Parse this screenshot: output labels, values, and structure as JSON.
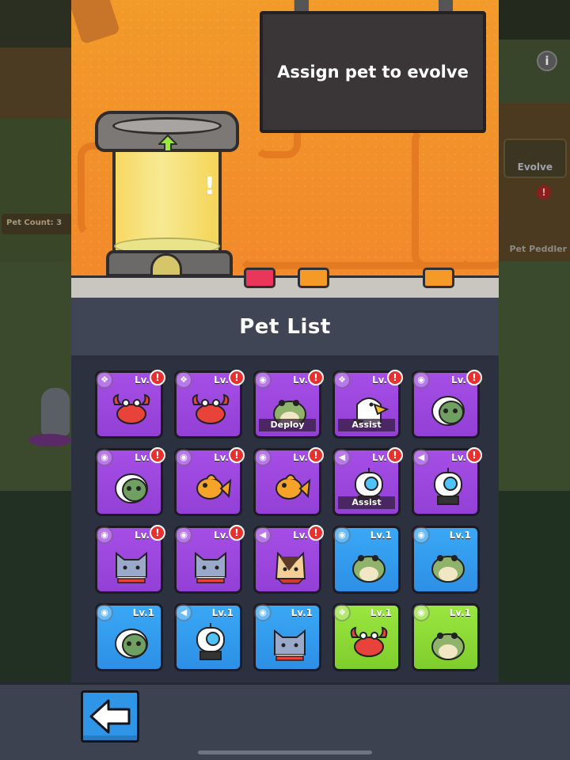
{
  "background": {
    "pet_count_label": "Pet Count: 3",
    "evolve_label": "Evolve",
    "peddler_label": "Pet Peddler",
    "info_icon": "i"
  },
  "sign": {
    "text": "Assign pet to evolve"
  },
  "pet_list": {
    "title": "Pet List",
    "pets": [
      {
        "name": "crab",
        "rarity": "purple",
        "level": "Lv.",
        "alert": "!",
        "type_icon": "❖",
        "tag": ""
      },
      {
        "name": "crab",
        "rarity": "purple",
        "level": "Lv.",
        "alert": "!",
        "type_icon": "❖",
        "tag": ""
      },
      {
        "name": "frog",
        "rarity": "purple",
        "level": "Lv.",
        "alert": "!",
        "type_icon": "◉",
        "tag": "Deploy"
      },
      {
        "name": "eagle",
        "rarity": "purple",
        "level": "Lv.",
        "alert": "!",
        "type_icon": "❖",
        "tag": "Assist"
      },
      {
        "name": "turtle",
        "rarity": "purple",
        "level": "Lv.",
        "alert": "!",
        "type_icon": "◉",
        "tag": ""
      },
      {
        "name": "turtle",
        "rarity": "purple",
        "level": "Lv.",
        "alert": "!",
        "type_icon": "◉",
        "tag": ""
      },
      {
        "name": "goldfish",
        "rarity": "purple",
        "level": "Lv.",
        "alert": "!",
        "type_icon": "◉",
        "tag": ""
      },
      {
        "name": "goldfish",
        "rarity": "purple",
        "level": "Lv.",
        "alert": "!",
        "type_icon": "◉",
        "tag": ""
      },
      {
        "name": "robot",
        "rarity": "purple",
        "level": "Lv.",
        "alert": "!",
        "type_icon": "◀",
        "tag": "Assist"
      },
      {
        "name": "robot",
        "rarity": "purple",
        "level": "Lv.",
        "alert": "!",
        "type_icon": "◀",
        "tag": ""
      },
      {
        "name": "cat",
        "rarity": "purple",
        "level": "Lv.",
        "alert": "!",
        "type_icon": "◉",
        "tag": ""
      },
      {
        "name": "cat",
        "rarity": "purple",
        "level": "Lv.",
        "alert": "!",
        "type_icon": "◉",
        "tag": ""
      },
      {
        "name": "dog",
        "rarity": "purple",
        "level": "Lv.",
        "alert": "!",
        "type_icon": "◀",
        "tag": ""
      },
      {
        "name": "frog",
        "rarity": "blue",
        "level": "Lv.1",
        "alert": "",
        "type_icon": "◉",
        "tag": ""
      },
      {
        "name": "frog",
        "rarity": "blue",
        "level": "Lv.1",
        "alert": "",
        "type_icon": "◉",
        "tag": ""
      },
      {
        "name": "turtle",
        "rarity": "blue",
        "level": "Lv.1",
        "alert": "",
        "type_icon": "◉",
        "tag": ""
      },
      {
        "name": "robot",
        "rarity": "blue",
        "level": "Lv.1",
        "alert": "",
        "type_icon": "◀",
        "tag": ""
      },
      {
        "name": "cat",
        "rarity": "blue",
        "level": "Lv.1",
        "alert": "",
        "type_icon": "◉",
        "tag": ""
      },
      {
        "name": "crab",
        "rarity": "green",
        "level": "Lv.1",
        "alert": "",
        "type_icon": "❖",
        "tag": ""
      },
      {
        "name": "frog",
        "rarity": "green",
        "level": "Lv.1",
        "alert": "",
        "type_icon": "◉",
        "tag": ""
      }
    ]
  },
  "back_button": {
    "icon": "back-arrow-icon"
  },
  "colors": {
    "lab_orange": "#f2892b",
    "card_purple": "#9340d6",
    "card_blue": "#2d8fe5",
    "card_green": "#7fcd2c",
    "alert_red": "#e8302e",
    "button_red": "#e9365a",
    "button_orange": "#f59a26",
    "back_button_blue": "#2f95e6"
  }
}
